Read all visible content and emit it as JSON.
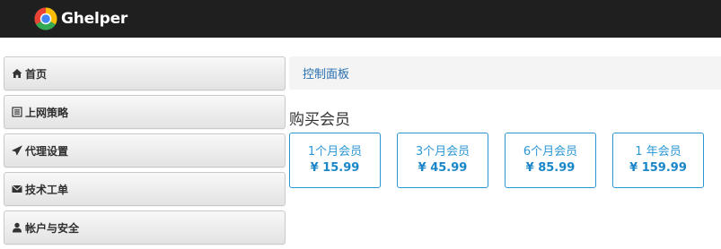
{
  "header": {
    "brand_name": "Ghelper",
    "colors": {
      "background": "#1f1f1f",
      "text": "#ffffff"
    }
  },
  "sidebar": {
    "items": [
      {
        "label": "首页",
        "icon": "home-icon"
      },
      {
        "label": "上网策略",
        "icon": "list-icon"
      },
      {
        "label": "代理设置",
        "icon": "send-icon"
      },
      {
        "label": "技术工单",
        "icon": "envelope-icon"
      },
      {
        "label": "帐户与安全",
        "icon": "user-icon"
      }
    ]
  },
  "breadcrumb": {
    "label": "控制面板"
  },
  "purchase": {
    "title": "购买会员",
    "plans": [
      {
        "name": "1个月会员",
        "price": "¥ 15.99"
      },
      {
        "name": "3个月会员",
        "price": "¥ 45.99"
      },
      {
        "name": "6个月会员",
        "price": "¥ 85.99"
      },
      {
        "name": "1 年会员",
        "price": "¥ 159.99"
      }
    ],
    "accent_color": "#2a97d4"
  }
}
